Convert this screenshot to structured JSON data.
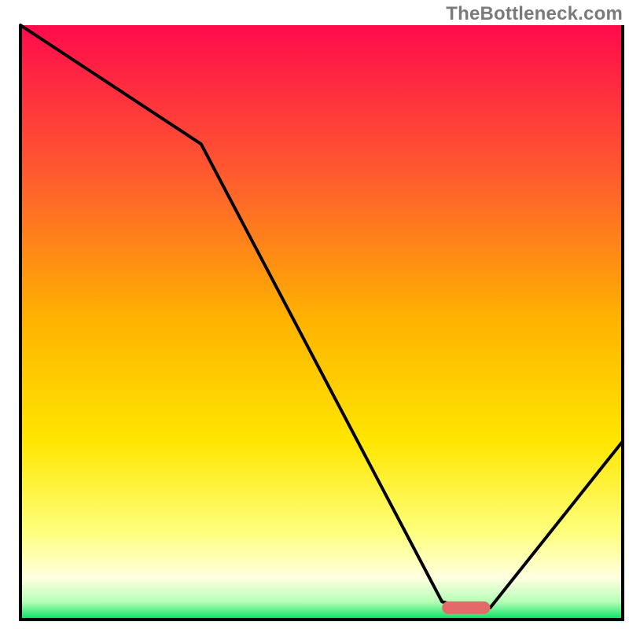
{
  "watermark": "TheBottleneck.com",
  "chart_data": {
    "type": "line",
    "title": "",
    "xlabel": "",
    "ylabel": "",
    "xlim": [
      0,
      100
    ],
    "ylim": [
      0,
      100
    ],
    "x": [
      0,
      30,
      70,
      74,
      78,
      100
    ],
    "values": [
      100,
      80,
      3,
      2,
      2,
      30
    ],
    "optimal_marker": {
      "x_start": 70,
      "x_end": 78,
      "y": 2
    },
    "gradient_stops": [
      {
        "offset": 0.0,
        "color": "#ff0b4c"
      },
      {
        "offset": 0.25,
        "color": "#ff5a2f"
      },
      {
        "offset": 0.5,
        "color": "#ffb400"
      },
      {
        "offset": 0.7,
        "color": "#ffe600"
      },
      {
        "offset": 0.85,
        "color": "#ffff7a"
      },
      {
        "offset": 0.93,
        "color": "#ffffe0"
      },
      {
        "offset": 0.97,
        "color": "#b8ffb8"
      },
      {
        "offset": 1.0,
        "color": "#00e060"
      }
    ],
    "line_color": "#000000",
    "marker_color": "#e46a6a",
    "frame_color": "#000000"
  }
}
